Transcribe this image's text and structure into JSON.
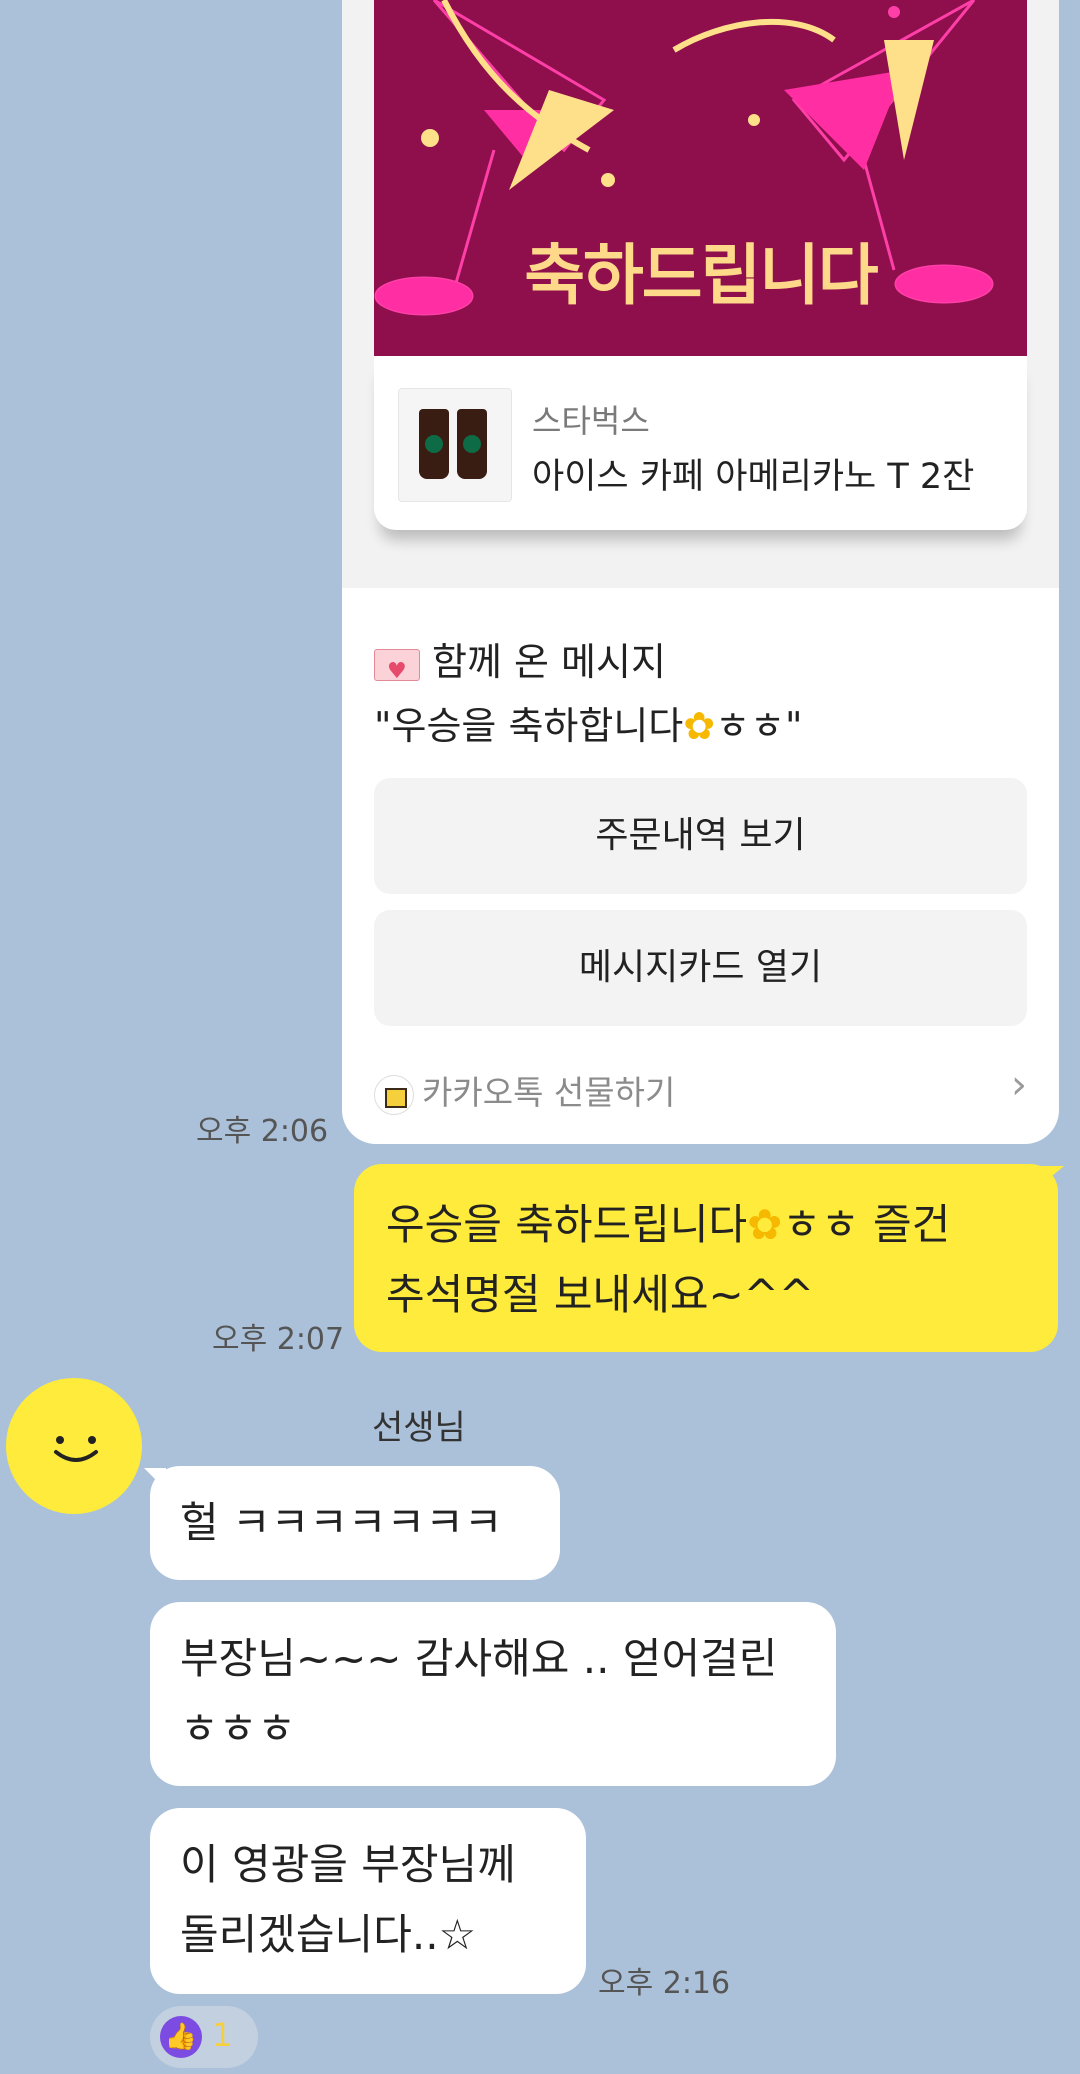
{
  "gift": {
    "banner_text": "축하드립니다",
    "brand": "스타벅스",
    "product": "아이스 카페 아메리카노 T 2잔",
    "message_header": "함께 온 메시지",
    "message_text": "\"우승을 축하합니다",
    "message_suffix": "ㅎㅎ\"",
    "order_button": "주문내역 보기",
    "card_button": "메시지카드 열기",
    "footer": "카카오톡 선물하기",
    "time": "오후 2:06"
  },
  "my_message": {
    "line1_a": "우승을 축하드립니다",
    "line1_b": "ㅎㅎ 즐건",
    "line2": "추석명절 보내세요~^^",
    "time": "오후 2:07"
  },
  "sender": {
    "name": "선생님"
  },
  "messages": [
    {
      "text": "헐 ㅋㅋㅋㅋㅋㅋㅋ"
    },
    {
      "line1": "부장님~~~ 감사해요 .. 얻어걸린",
      "line2": "ㅎㅎㅎ"
    },
    {
      "line1": "이 영광을 부장님께",
      "line2": "돌리겠습니다..☆",
      "time": "오후 2:16"
    }
  ],
  "reaction": {
    "icon": "thumbs-up-icon",
    "count": "1"
  },
  "colors": {
    "background": "#abc1d9",
    "my_bubble": "#ffeb3b",
    "banner": "#8e0f4c"
  }
}
